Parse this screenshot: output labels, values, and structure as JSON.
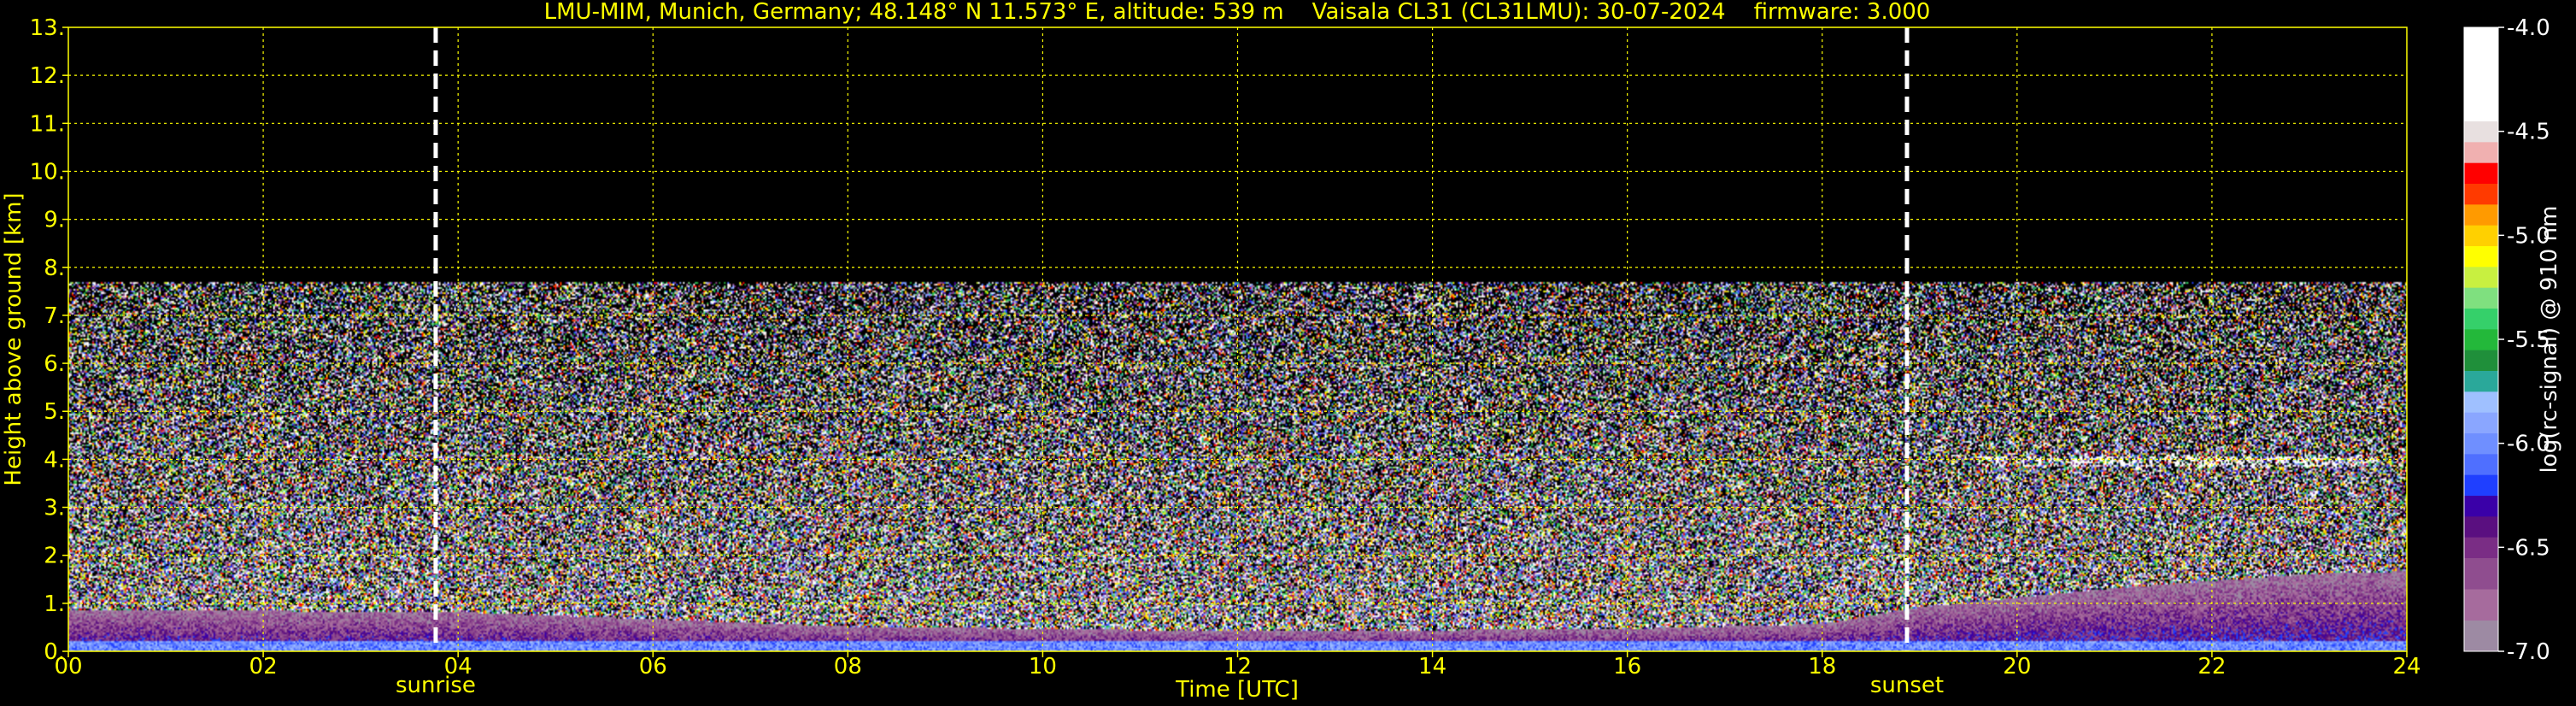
{
  "chart_data": {
    "type": "heatmap",
    "title": "LMU-MIM, Munich, Germany; 48.148° N 11.573° E, altitude: 539 m    Vaisala CL31 (CL31LMU): 30-07-2024    firmware: 3.000",
    "xlabel": "Time [UTC]",
    "ylabel": "Height above ground [km]",
    "xlim": [
      0,
      24
    ],
    "ylim": [
      0,
      13
    ],
    "x_ticks": [
      {
        "value": 0,
        "label": "00"
      },
      {
        "value": 2,
        "label": "02"
      },
      {
        "value": 4,
        "label": "04"
      },
      {
        "value": 6,
        "label": "06"
      },
      {
        "value": 8,
        "label": "08"
      },
      {
        "value": 10,
        "label": "10"
      },
      {
        "value": 12,
        "label": "12"
      },
      {
        "value": 14,
        "label": "14"
      },
      {
        "value": 16,
        "label": "16"
      },
      {
        "value": 18,
        "label": "18"
      },
      {
        "value": 20,
        "label": "20"
      },
      {
        "value": 22,
        "label": "22"
      },
      {
        "value": 24,
        "label": "24"
      }
    ],
    "y_ticks": [
      {
        "value": 0,
        "label": "0."
      },
      {
        "value": 1,
        "label": "1."
      },
      {
        "value": 2,
        "label": "2."
      },
      {
        "value": 3,
        "label": "3."
      },
      {
        "value": 4,
        "label": "4."
      },
      {
        "value": 5,
        "label": "5."
      },
      {
        "value": 6,
        "label": "6."
      },
      {
        "value": 7,
        "label": "7."
      },
      {
        "value": 8,
        "label": "8."
      },
      {
        "value": 9,
        "label": "9."
      },
      {
        "value": 10,
        "label": "10."
      },
      {
        "value": 11,
        "label": "11."
      },
      {
        "value": 12,
        "label": "12."
      },
      {
        "value": 13,
        "label": "13."
      }
    ],
    "grid": true,
    "signal_top_km": 7.7,
    "events": [
      {
        "label": "sunrise",
        "time": 3.77
      },
      {
        "label": "sunset",
        "time": 18.87
      }
    ],
    "colorbar": {
      "label": "log(rc-signal) @ 910 nm",
      "range": [
        -7.0,
        -4.0
      ],
      "ticks": [
        {
          "value": -4.0,
          "label": "-4.0"
        },
        {
          "value": -4.5,
          "label": "-4.5"
        },
        {
          "value": -5.0,
          "label": "-5.0"
        },
        {
          "value": -5.5,
          "label": "-5.5"
        },
        {
          "value": -6.0,
          "label": "-6.0"
        },
        {
          "value": -6.5,
          "label": "-6.5"
        },
        {
          "value": -7.0,
          "label": "-7.0"
        }
      ],
      "stops": [
        {
          "from": -7.0,
          "to": -6.85,
          "color": "#9d8aa3"
        },
        {
          "from": -6.85,
          "to": -6.7,
          "color": "#a66b9d"
        },
        {
          "from": -6.7,
          "to": -6.55,
          "color": "#8f4d8f"
        },
        {
          "from": -6.55,
          "to": -6.45,
          "color": "#7a2d85"
        },
        {
          "from": -6.45,
          "to": -6.35,
          "color": "#5a0f80"
        },
        {
          "from": -6.35,
          "to": -6.25,
          "color": "#3a00a8"
        },
        {
          "from": -6.25,
          "to": -6.15,
          "color": "#1f3fff"
        },
        {
          "from": -6.15,
          "to": -6.05,
          "color": "#4f6fff"
        },
        {
          "from": -6.05,
          "to": -5.95,
          "color": "#6f8fff"
        },
        {
          "from": -5.95,
          "to": -5.85,
          "color": "#8aa6ff"
        },
        {
          "from": -5.85,
          "to": -5.75,
          "color": "#9fc0ff"
        },
        {
          "from": -5.75,
          "to": -5.65,
          "color": "#2aa89a"
        },
        {
          "from": -5.65,
          "to": -5.55,
          "color": "#1f8f3a"
        },
        {
          "from": -5.55,
          "to": -5.45,
          "color": "#23b83a"
        },
        {
          "from": -5.45,
          "to": -5.35,
          "color": "#35d06a"
        },
        {
          "from": -5.35,
          "to": -5.25,
          "color": "#7fe07f"
        },
        {
          "from": -5.25,
          "to": -5.15,
          "color": "#c8f040"
        },
        {
          "from": -5.15,
          "to": -5.05,
          "color": "#ffff00"
        },
        {
          "from": -5.05,
          "to": -4.95,
          "color": "#ffd000"
        },
        {
          "from": -4.95,
          "to": -4.85,
          "color": "#ff9a00"
        },
        {
          "from": -4.85,
          "to": -4.75,
          "color": "#ff3a00"
        },
        {
          "from": -4.75,
          "to": -4.65,
          "color": "#ff0000"
        },
        {
          "from": -4.65,
          "to": -4.55,
          "color": "#f0b0b0"
        },
        {
          "from": -4.55,
          "to": -4.45,
          "color": "#e8e0e0"
        },
        {
          "from": -4.45,
          "to": -4.0,
          "color": "#ffffff"
        }
      ]
    },
    "features": [
      {
        "name": "surface layer",
        "from_time": 0,
        "to_time": 24,
        "top_km": 0.2,
        "color": "#2a3cff"
      },
      {
        "name": "boundary layer",
        "points": [
          [
            0,
            0.85
          ],
          [
            4,
            0.8
          ],
          [
            8,
            0.5
          ],
          [
            12,
            0.4
          ],
          [
            16,
            0.45
          ],
          [
            18,
            0.55
          ],
          [
            19,
            0.9
          ],
          [
            21,
            1.3
          ],
          [
            23,
            1.6
          ],
          [
            24,
            1.65
          ]
        ],
        "color": "#7a2d85"
      },
      {
        "name": "cloud layer",
        "from_time": 19.6,
        "to_time": 23.7,
        "height_km": 3.95,
        "color": "#ffffff"
      }
    ]
  },
  "colors": {
    "axis": "#ffff00",
    "grid": "#ffff00",
    "background": "#000000",
    "event_line": "#ffffff"
  }
}
